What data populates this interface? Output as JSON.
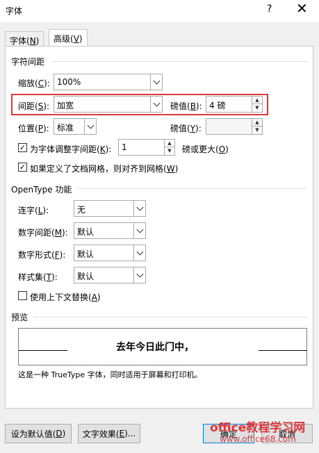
{
  "dialog": {
    "title": "字体",
    "help": "?",
    "close": "✕"
  },
  "tabs": [
    {
      "label": "字体(N)",
      "pre": "字体(",
      "key": "N",
      "post": ")",
      "active": false
    },
    {
      "label": "高级(V)",
      "pre": "高级(",
      "key": "V",
      "post": ")",
      "active": true
    }
  ],
  "char_spacing": {
    "heading": "字符间距",
    "scale": {
      "pre": "缩放(",
      "key": "C",
      "post": "):",
      "value": "100%"
    },
    "spacing": {
      "pre": "间距(",
      "key": "S",
      "post": "):",
      "value": "加宽"
    },
    "spacing_points": {
      "pre": "磅值(",
      "key": "B",
      "post": "):",
      "value": "4 磅"
    },
    "position": {
      "pre": "位置(",
      "key": "P",
      "post": "):",
      "value": "标准"
    },
    "position_points": {
      "pre": "磅值(",
      "key": "Y",
      "post": "):",
      "value": ""
    },
    "kerning": {
      "pre": "为字体调整字间距(",
      "key": "K",
      "post": "):",
      "value": "1",
      "suffix_pre": "磅或更大(",
      "suffix_key": "O",
      "suffix_post": ")",
      "checked": true
    },
    "grid": {
      "pre": "如果定义了文档网格，则对齐到网格(",
      "key": "W",
      "post": ")",
      "checked": true
    }
  },
  "opentype": {
    "heading": "OpenType 功能",
    "ligatures": {
      "pre": "连字(",
      "key": "L",
      "post": "):",
      "value": "无"
    },
    "number_spacing": {
      "pre": "数字间距(",
      "key": "M",
      "post": "):",
      "value": "默认"
    },
    "number_forms": {
      "pre": "数字形式(",
      "key": "F",
      "post": "):",
      "value": "默认"
    },
    "stylistic_sets": {
      "pre": "样式集(",
      "key": "T",
      "post": "):",
      "value": "默认"
    },
    "contextual": {
      "pre": "使用上下文替换(",
      "key": "A",
      "post": ")",
      "checked": false
    }
  },
  "preview": {
    "heading": "预览",
    "text": "去年今日此门中，",
    "note": "这是一种 TrueType 字体，同时适用于屏幕和打印机。"
  },
  "buttons": {
    "set_default": {
      "pre": "设为默认值(",
      "key": "D",
      "post": ")"
    },
    "text_effects": {
      "pre": "文字效果(",
      "key": "E",
      "post": ")..."
    },
    "ok": "确定",
    "cancel": "取消"
  },
  "watermark": {
    "line1": "office教程学习网",
    "line2": "www.office68.com"
  },
  "colors": {
    "highlight": "#d9383f",
    "accent": "#0078d7"
  }
}
